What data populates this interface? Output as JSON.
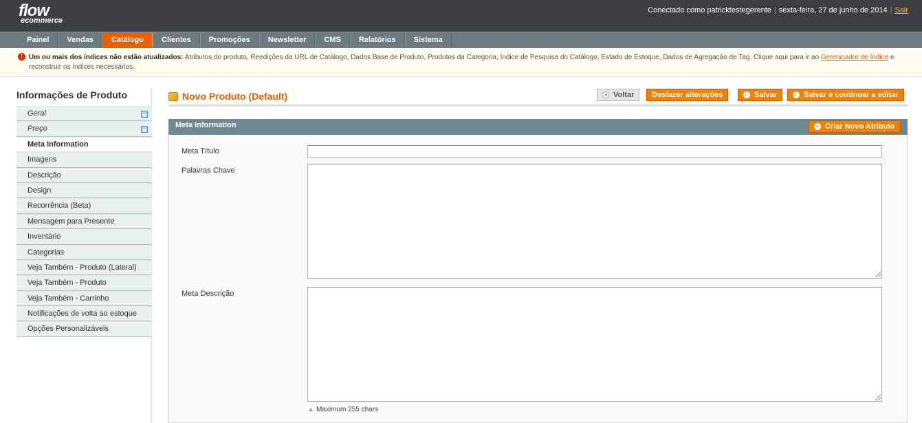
{
  "header": {
    "logo_main": "flow",
    "logo_sub": "ecommerce",
    "user_text": "Conectado como patricktestegerente",
    "date_text": "sexta-feira, 27 de junho de 2014",
    "logout_label": "Sair"
  },
  "nav": {
    "items": [
      "Painel",
      "Vendas",
      "Catálogo",
      "Clientes",
      "Promoções",
      "Newsletter",
      "CMS",
      "Relatórios",
      "Sistema"
    ],
    "active": "Catálogo"
  },
  "notice": {
    "bold_text": "Um ou mais dos índices não estão atualizados:",
    "text": "Atributos do produto, Reedições da URL de Catálogo, Dados Base de Produto, Produtos da Categoria, Índice de Pesquisa do Catálogo, Estado de Estoque, Dados de Agregação de Tag. Clique aqui para ir ao",
    "link_text": "Gerenciador de Índice",
    "tail_text": "e reconstruir os índices necessários."
  },
  "sidebar": {
    "title": "Informações de Produto",
    "tabs": [
      {
        "label": "Geral"
      },
      {
        "label": "Preço"
      },
      {
        "label": "Meta Information"
      },
      {
        "label": "Imagens"
      },
      {
        "label": "Descrição"
      },
      {
        "label": "Design"
      },
      {
        "label": "Recorrência (Beta)"
      },
      {
        "label": "Mensagem para Presente"
      },
      {
        "label": "Inventário"
      },
      {
        "label": "Categorias"
      },
      {
        "label": "Veja Também - Produto (Lateral)"
      },
      {
        "label": "Veja Também - Produto"
      },
      {
        "label": "Veja Também - Carrinho"
      },
      {
        "label": "Notificações de volta ao estoque"
      },
      {
        "label": "Opções Personalizáveis"
      }
    ]
  },
  "content": {
    "title": "Novo Produto (Default)",
    "buttons": {
      "back": "Voltar",
      "reset": "Desfazer alterações",
      "save": "Salvar",
      "save_continue": "Salvar e continuar a editar"
    },
    "fieldset": {
      "title": "Meta Information",
      "new_attribute": "Criar Novo Atributo",
      "fields": {
        "meta_title_label": "Meta Título",
        "meta_title_value": "",
        "keywords_label": "Palavras Chave",
        "keywords_value": "",
        "description_label": "Meta Descrição",
        "description_value": "",
        "description_note": "Maximum 255 chars"
      }
    }
  },
  "colors": {
    "accent": "#eb5e00",
    "header_bg": "#3d3e44",
    "nav_bg": "#6d7b81",
    "fieldset_head": "#6f8992"
  }
}
